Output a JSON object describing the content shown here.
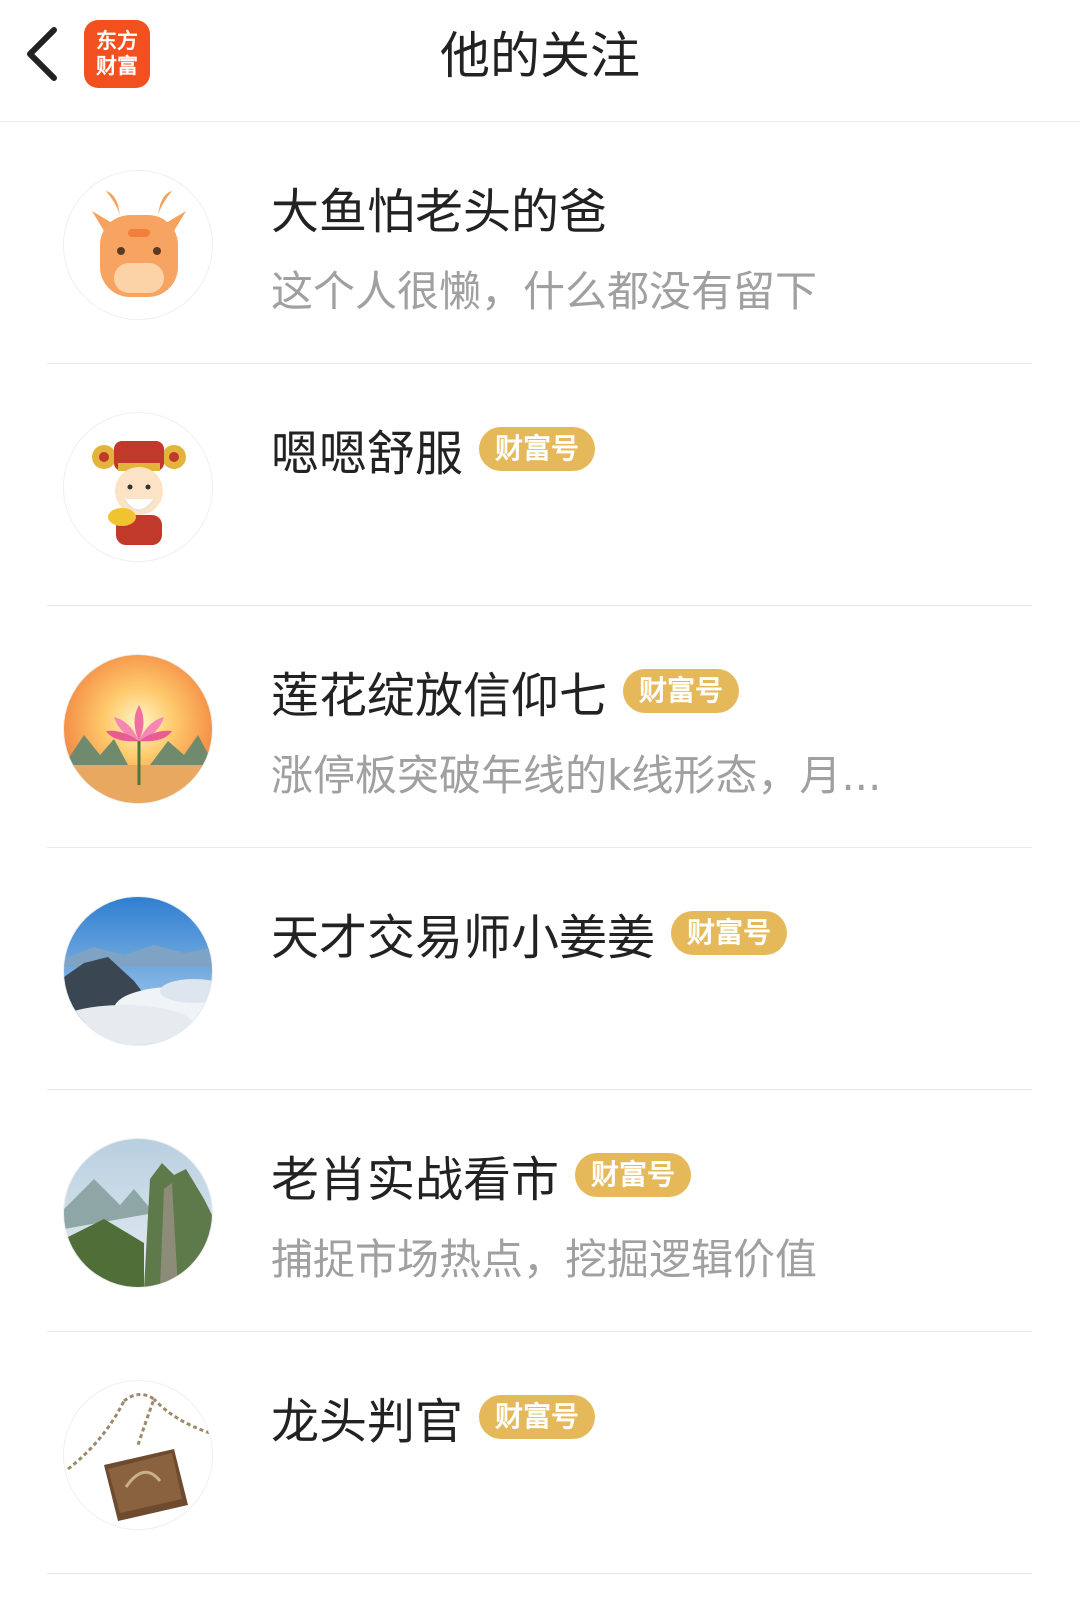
{
  "header": {
    "title": "他的关注",
    "logo_line1": "东方",
    "logo_line2": "财富",
    "back_icon": "chevron-left-icon"
  },
  "colors": {
    "badge": "#e5b95a",
    "logo": "#f2501e",
    "desc": "#a0a0a0"
  },
  "follows": [
    {
      "name": "大鱼怕老头的爸",
      "badge": "",
      "desc": "这个人很懒，什么都没有留下",
      "avatar": "cow-avatar"
    },
    {
      "name": "嗯嗯舒服",
      "badge": "财富号",
      "desc": "",
      "avatar": "god-of-wealth-avatar"
    },
    {
      "name": "莲花绽放信仰七",
      "badge": "财富号",
      "desc": "涨停板突破年线的k线形态，月...",
      "avatar": "lotus-avatar"
    },
    {
      "name": "天才交易师小姜姜",
      "badge": "财富号",
      "desc": "",
      "avatar": "sea-of-clouds-avatar"
    },
    {
      "name": "老肖实战看市",
      "badge": "财富号",
      "desc": "捕捉市场热点，挖掘逻辑价值",
      "avatar": "mountain-avatar"
    },
    {
      "name": "龙头判官",
      "badge": "财富号",
      "desc": "",
      "avatar": "notebook-pendant-avatar"
    }
  ]
}
